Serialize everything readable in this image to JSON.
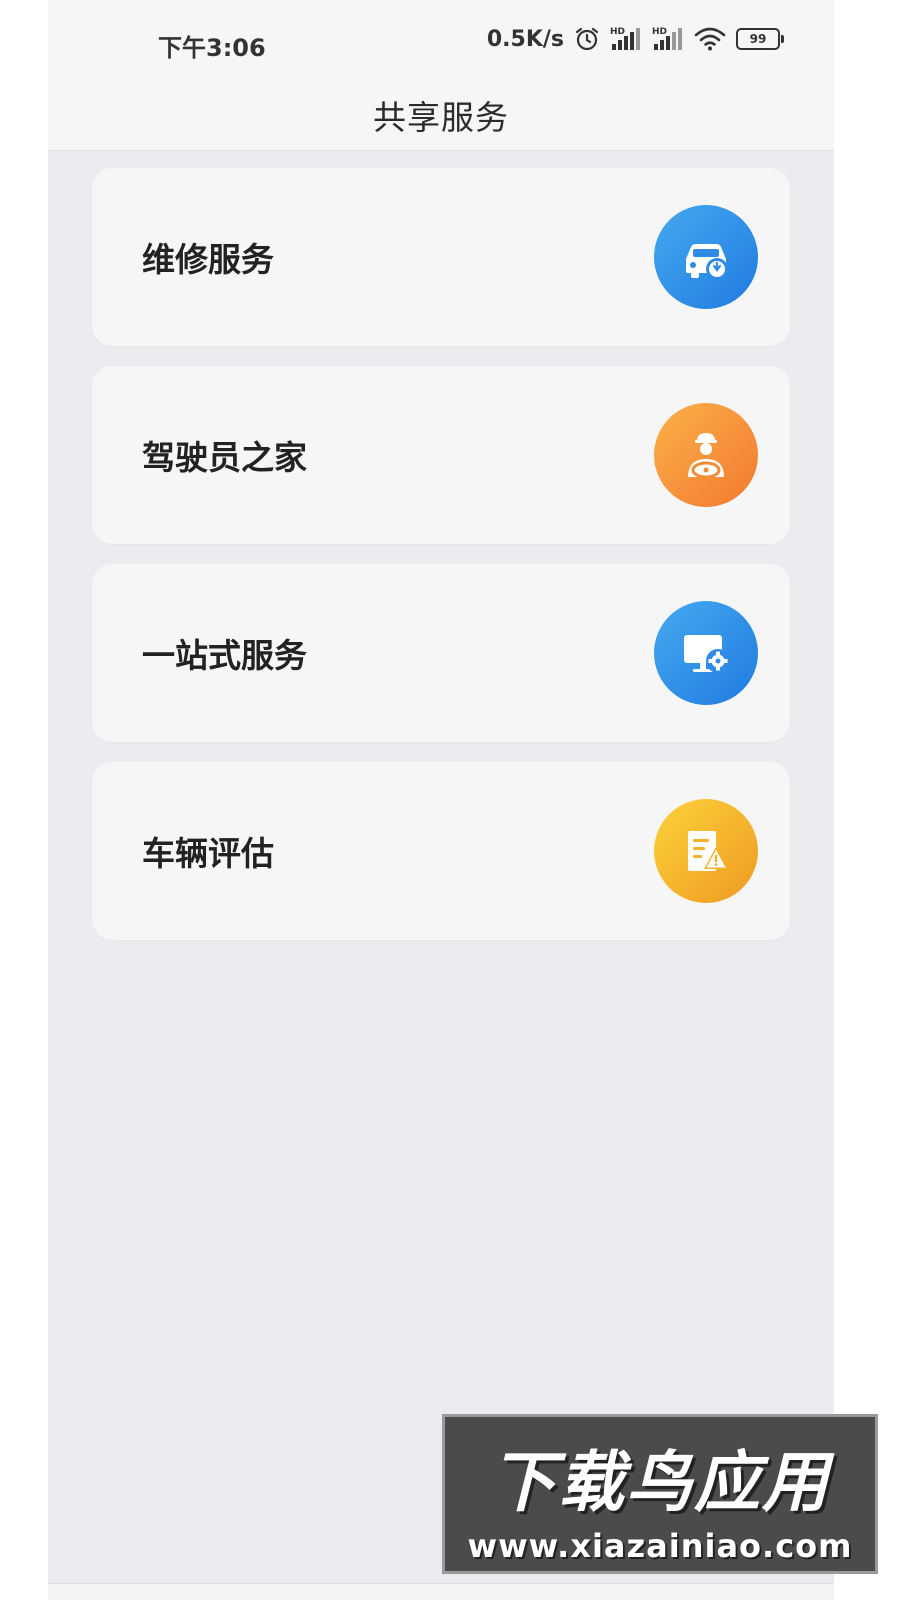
{
  "status_bar": {
    "time": "下午3:06",
    "net_speed": "0.5K/s",
    "signal_tag_1": "HD",
    "signal_tag_2": "HD",
    "battery": "99",
    "icons": [
      "alarm-icon",
      "signal-hd-icon",
      "signal-hd-icon",
      "wifi-icon",
      "battery-icon"
    ]
  },
  "header": {
    "title": "共享服务"
  },
  "services": [
    {
      "label": "维修服务",
      "icon": "car-repair-icon",
      "gradient": [
        "#46a9f0",
        "#1f7be0"
      ]
    },
    {
      "label": "驾驶员之家",
      "icon": "driver-icon",
      "gradient": [
        "#fbb24a",
        "#f3782f"
      ]
    },
    {
      "label": "一站式服务",
      "icon": "monitor-gear-icon",
      "gradient": [
        "#46a9f0",
        "#1f7be0"
      ]
    },
    {
      "label": "车辆评估",
      "icon": "report-warning-icon",
      "gradient": [
        "#fbd23a",
        "#f09a23"
      ]
    }
  ],
  "watermark": {
    "title": "下载鸟应用",
    "url": "www.xiazainiao.com"
  },
  "colors": {
    "background": "#ebecef",
    "card": "#f6f6f7",
    "blue_accent": "#2f8be6",
    "orange_accent": "#f58b35",
    "yellow_accent": "#f4b22c"
  }
}
